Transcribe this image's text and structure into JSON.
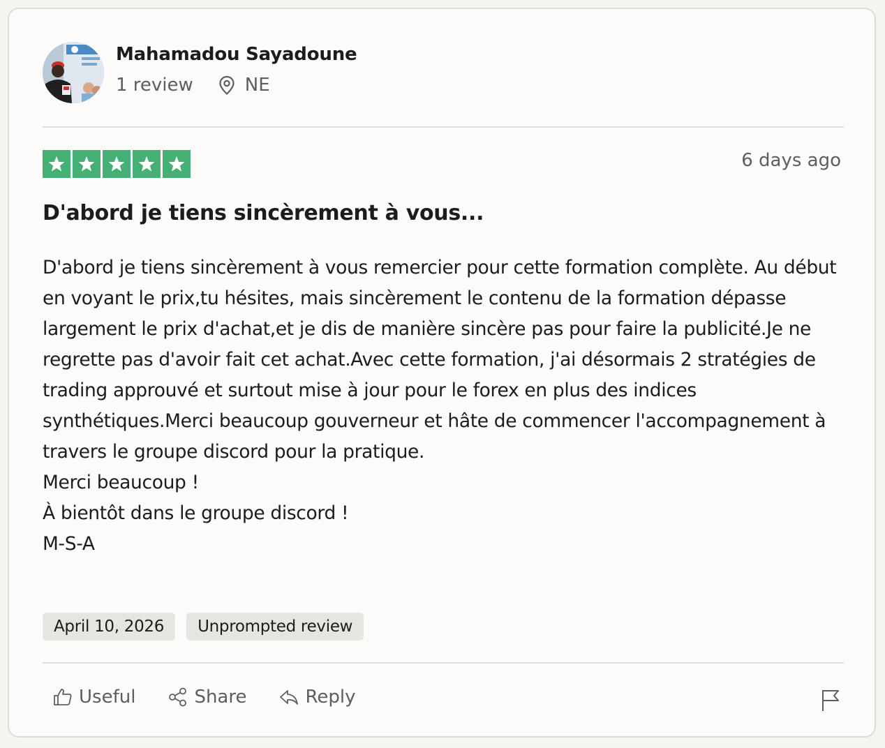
{
  "reviewer": {
    "name": "Mahamadou Sayadoune",
    "review_count": "1 review",
    "location_icon": "map-pin-icon",
    "country": "NE"
  },
  "rating": {
    "stars": 5,
    "max": 5,
    "color": "#45b075"
  },
  "review": {
    "posted_ago": "6 days ago",
    "title": "D'abord je tiens sincèrement à vous...",
    "body": "D'abord je tiens sincèrement à vous remercier pour cette formation complète. Au début en voyant le prix,tu hésites, mais sincèrement le contenu de la formation dépasse largement le prix d'achat,et je dis de manière sincère pas pour faire la publicité.Je ne regrette pas d'avoir fait cet achat.Avec cette formation, j'ai désormais 2 stratégies de trading approuvé et surtout mise à jour pour le forex en plus des indices synthétiques.Merci beaucoup gouverneur et hâte de commencer l'accompagnement à travers le groupe discord pour la pratique.\nMerci beaucoup !\nÀ bientôt dans le groupe discord !\nM-S-A"
  },
  "tags": {
    "date": "April 10, 2026",
    "type": "Unprompted review"
  },
  "actions": {
    "useful": {
      "label": "Useful",
      "icon": "thumbs-up-icon"
    },
    "share": {
      "label": "Share",
      "icon": "share-icon"
    },
    "reply": {
      "label": "Reply",
      "icon": "reply-icon"
    },
    "report": {
      "icon": "flag-icon"
    }
  }
}
